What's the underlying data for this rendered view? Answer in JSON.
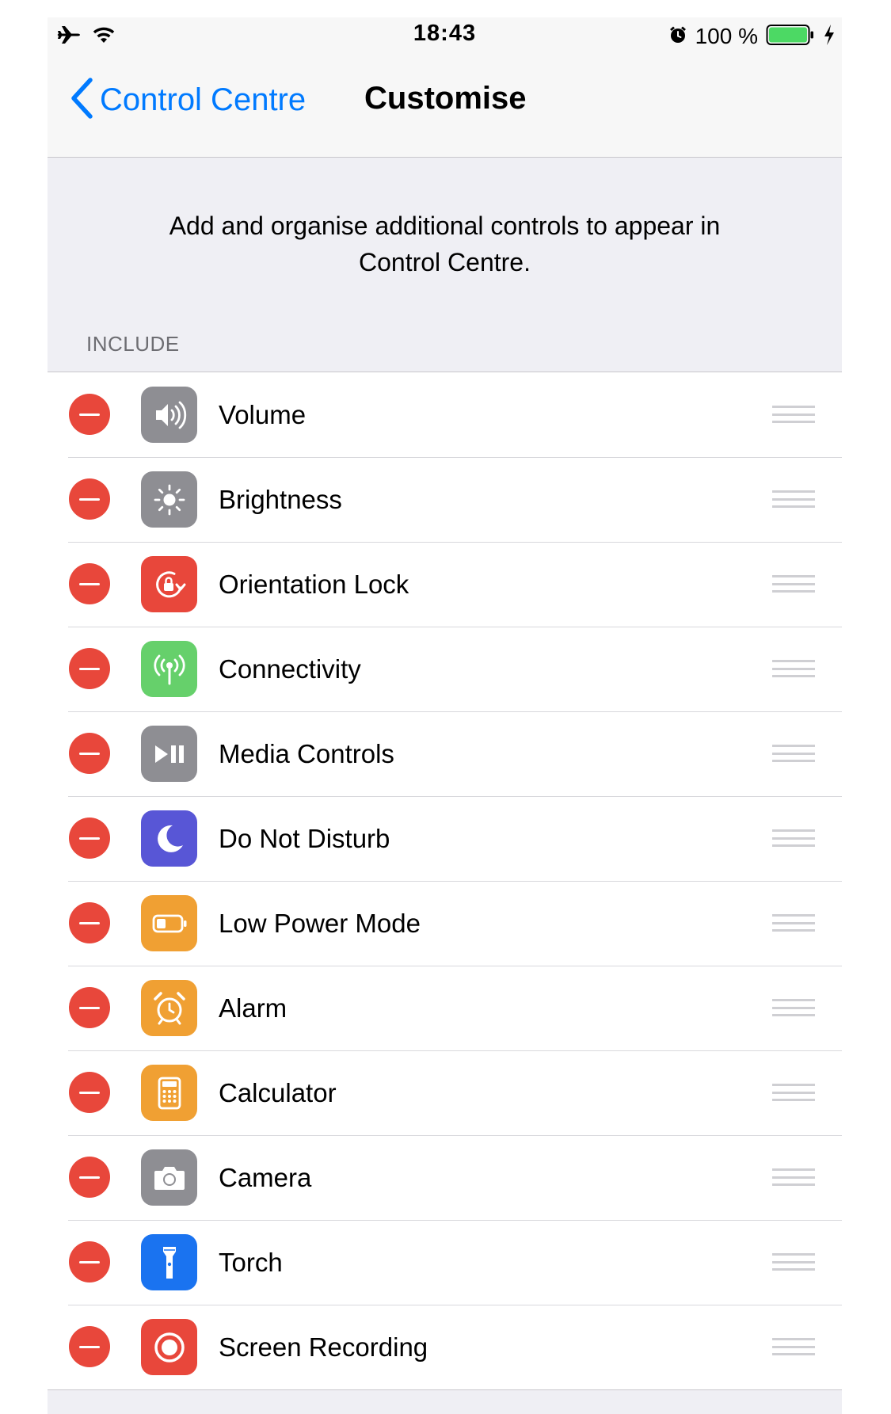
{
  "status_bar": {
    "time": "18:43",
    "battery_text": "100 %",
    "icons": [
      "airplane-icon",
      "wifi-icon",
      "alarm-icon",
      "battery-icon",
      "charging-icon"
    ]
  },
  "nav": {
    "back_label": "Control Centre",
    "title": "Customise"
  },
  "description": "Add and organise additional controls to appear in Control Centre.",
  "section_header": "INCLUDE",
  "items": [
    {
      "label": "Volume",
      "icon": "speaker-icon",
      "color": "#8e8e93"
    },
    {
      "label": "Brightness",
      "icon": "sun-icon",
      "color": "#8e8e93"
    },
    {
      "label": "Orientation Lock",
      "icon": "rotation-lock-icon",
      "color": "#e8473b"
    },
    {
      "label": "Connectivity",
      "icon": "antenna-icon",
      "color": "#66d06b"
    },
    {
      "label": "Media Controls",
      "icon": "play-pause-icon",
      "color": "#8e8e93"
    },
    {
      "label": "Do Not Disturb",
      "icon": "moon-icon",
      "color": "#5856d6"
    },
    {
      "label": "Low Power Mode",
      "icon": "battery-low-icon",
      "color": "#f0a033"
    },
    {
      "label": "Alarm",
      "icon": "alarm-clock-icon",
      "color": "#f0a033"
    },
    {
      "label": "Calculator",
      "icon": "calculator-icon",
      "color": "#f0a033"
    },
    {
      "label": "Camera",
      "icon": "camera-icon",
      "color": "#8e8e93"
    },
    {
      "label": "Torch",
      "icon": "torch-icon",
      "color": "#1a73f0"
    },
    {
      "label": "Screen Recording",
      "icon": "record-icon",
      "color": "#e8473b"
    }
  ]
}
